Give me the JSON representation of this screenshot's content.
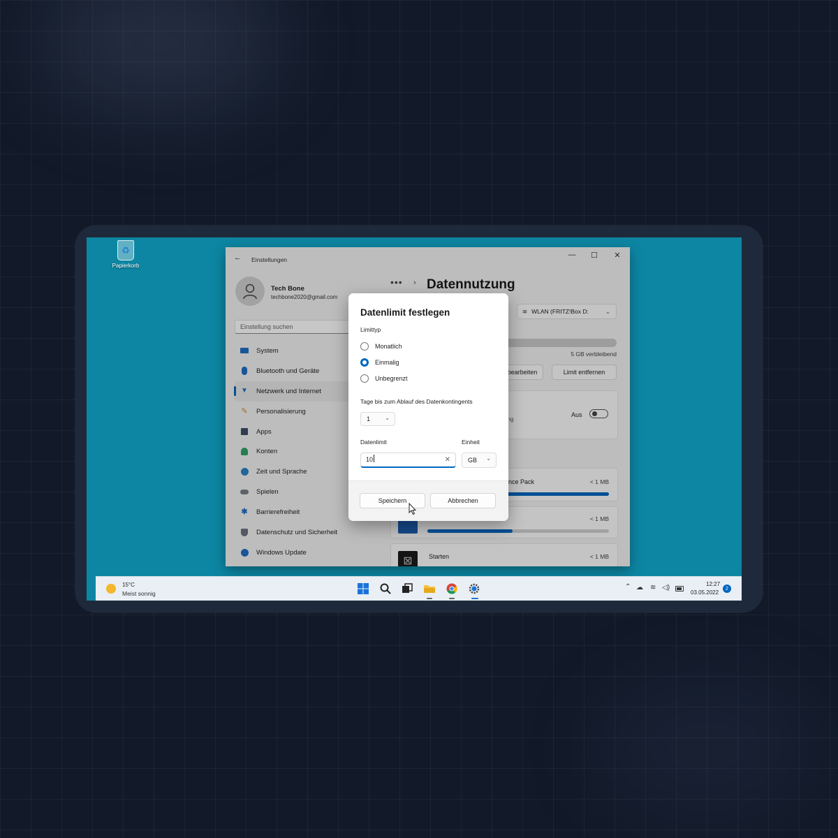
{
  "desktop": {
    "recycle_bin_label": "Papierkorb"
  },
  "window": {
    "title": "Einstellungen",
    "minimize": "—",
    "maximize": "☐",
    "close": "✕",
    "back": "←"
  },
  "profile": {
    "name": "Tech Bone",
    "email": "techbone2020@gmail.com"
  },
  "search": {
    "placeholder": "Einstellung suchen"
  },
  "nav": {
    "items": [
      {
        "label": "System",
        "icon": "monitor-icon"
      },
      {
        "label": "Bluetooth und Geräte",
        "icon": "bluetooth-icon"
      },
      {
        "label": "Netzwerk und Internet",
        "icon": "wifi-icon",
        "active": true
      },
      {
        "label": "Personalisierung",
        "icon": "brush-icon"
      },
      {
        "label": "Apps",
        "icon": "apps-icon"
      },
      {
        "label": "Konten",
        "icon": "person-icon"
      },
      {
        "label": "Zeit und Sprache",
        "icon": "globe-icon"
      },
      {
        "label": "Spielen",
        "icon": "gamepad-icon"
      },
      {
        "label": "Barrierefreiheit",
        "icon": "accessibility-icon"
      },
      {
        "label": "Datenschutz und Sicherheit",
        "icon": "shield-icon"
      },
      {
        "label": "Windows Update",
        "icon": "update-icon"
      }
    ]
  },
  "main": {
    "breadcrumb_dots": "•••",
    "breadcrumb_chevron": "›",
    "title": "Datennutzung",
    "network_select": "WLAN (FRITZ!Box D:",
    "remaining": "5 GB verbleibend",
    "edit_button": "bearbeiten",
    "remove_limit_button": "Limit entfernen",
    "setting_desc": "ung",
    "toggle_label": "Aus",
    "apps": [
      {
        "name": "nce Pack",
        "size": "< 1 MB",
        "usage": 1.0
      },
      {
        "name": "",
        "size": "< 1 MB",
        "usage": 0.47
      },
      {
        "name": "Starten",
        "size": "< 1 MB"
      }
    ]
  },
  "dialog": {
    "title": "Datenlimit festlegen",
    "limit_type_label": "Limittyp",
    "options": [
      "Monatlich",
      "Einmalig",
      "Unbegrenzt"
    ],
    "selected_option": "Einmalig",
    "days_label": "Tage bis zum Ablauf des Datenkontingents",
    "days_value": "1",
    "data_limit_label": "Datenlimit",
    "data_limit_value": "10",
    "unit_label": "Einheit",
    "unit_value": "GB",
    "save_button": "Speichern",
    "cancel_button": "Abbrechen"
  },
  "taskbar": {
    "weather_temp": "15°C",
    "weather_desc": "Meist sonnig",
    "time": "12:27",
    "date": "03.05.2022",
    "notification_count": "2"
  },
  "colors": {
    "accent": "#0067c0",
    "desktop": "#0d86a3",
    "page_bg": "#121a29"
  }
}
